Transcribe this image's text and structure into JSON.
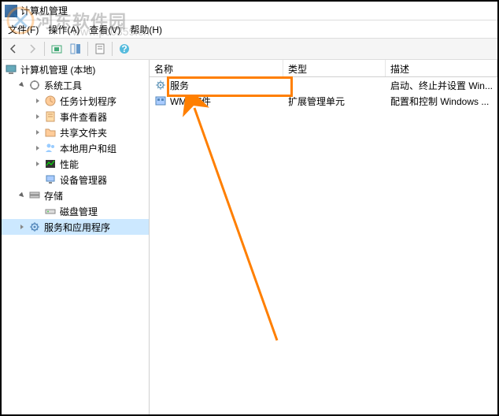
{
  "window": {
    "title": "计算机管理"
  },
  "menu": {
    "file": "文件(F)",
    "action": "操作(A)",
    "view": "查看(V)",
    "help": "帮助(H)"
  },
  "tree": {
    "root": "计算机管理 (本地)",
    "system_tools": "系统工具",
    "task_scheduler": "任务计划程序",
    "event_viewer": "事件查看器",
    "shared_folders": "共享文件夹",
    "local_users": "本地用户和组",
    "performance": "性能",
    "device_manager": "设备管理器",
    "storage": "存储",
    "disk_management": "磁盘管理",
    "services_apps": "服务和应用程序"
  },
  "columns": {
    "name": "名称",
    "type": "类型",
    "desc": "描述"
  },
  "rows": [
    {
      "name": "服务",
      "type": "",
      "desc": "启动、终止并设置 Win..."
    },
    {
      "name": "WMI 控件",
      "type": "扩展管理单元",
      "desc": "配置和控制 Windows ..."
    }
  ],
  "watermark": {
    "text1": "河东软件园",
    "text2": "www.pc0359.cn"
  }
}
